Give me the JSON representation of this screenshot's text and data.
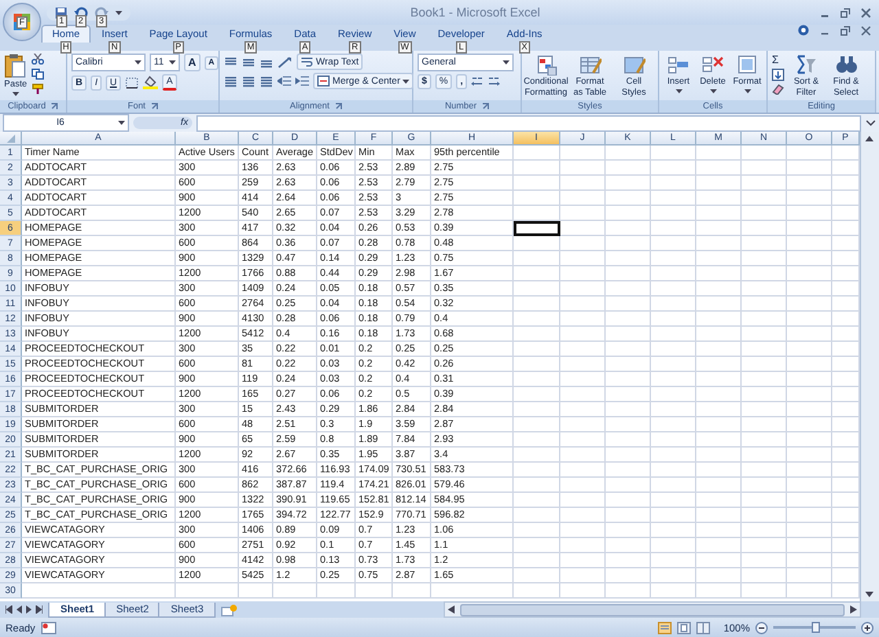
{
  "window": {
    "title": "Book1 - Microsoft Excel",
    "office_keytip": "F",
    "quick_access_keytips": [
      "1",
      "2",
      "3"
    ]
  },
  "tabs": [
    {
      "label": "Home",
      "keytip": "H",
      "selected": true
    },
    {
      "label": "Insert",
      "keytip": "N",
      "selected": false
    },
    {
      "label": "Page Layout",
      "keytip": "P",
      "selected": false
    },
    {
      "label": "Formulas",
      "keytip": "M",
      "selected": false
    },
    {
      "label": "Data",
      "keytip": "A",
      "selected": false
    },
    {
      "label": "Review",
      "keytip": "R",
      "selected": false
    },
    {
      "label": "View",
      "keytip": "W",
      "selected": false
    },
    {
      "label": "Developer",
      "keytip": "L",
      "selected": false
    },
    {
      "label": "Add-Ins",
      "keytip": "X",
      "selected": false
    }
  ],
  "clipboard": {
    "label": "Clipboard",
    "paste": "Paste"
  },
  "font": {
    "label": "Font",
    "name": "Calibri",
    "size": "11",
    "grow": "A",
    "shrink": "A",
    "bold": "B",
    "italic": "I",
    "underline": "U",
    "color_button": "A"
  },
  "alignment": {
    "label": "Alignment",
    "wrap": "Wrap Text",
    "merge": "Merge & Center"
  },
  "number": {
    "label": "Number",
    "format": "General",
    "currency": "$",
    "percent": "%",
    "comma": ","
  },
  "styles": {
    "label": "Styles",
    "buttons": [
      "Conditional Formatting",
      "Format as Table",
      "Cell Styles"
    ]
  },
  "cells_group": {
    "label": "Cells",
    "buttons": [
      "Insert",
      "Delete",
      "Format"
    ]
  },
  "editing": {
    "label": "Editing",
    "sum": "Σ",
    "buttons": [
      "Sort & Filter",
      "Find & Select"
    ]
  },
  "formula_bar": {
    "name_box": "I6",
    "function_label": "fx"
  },
  "columns": [
    {
      "label": "A",
      "selected": false
    },
    {
      "label": "B",
      "selected": false
    },
    {
      "label": "C",
      "selected": false
    },
    {
      "label": "D",
      "selected": false
    },
    {
      "label": "E",
      "selected": false
    },
    {
      "label": "F",
      "selected": false
    },
    {
      "label": "G",
      "selected": false
    },
    {
      "label": "H",
      "selected": false
    },
    {
      "label": "I",
      "selected": true
    },
    {
      "label": "J",
      "selected": false
    },
    {
      "label": "K",
      "selected": false
    },
    {
      "label": "L",
      "selected": false
    },
    {
      "label": "M",
      "selected": false
    },
    {
      "label": "N",
      "selected": false
    },
    {
      "label": "O",
      "selected": false
    },
    {
      "label": "P",
      "selected": false
    }
  ],
  "rows": [
    {
      "number": "1",
      "selected": false,
      "cells": [
        "Timer Name",
        "Active Users",
        "Count",
        "Average",
        "StdDev",
        "Min",
        "Max",
        "95th percentile"
      ]
    },
    {
      "number": "2",
      "selected": false,
      "cells": [
        "ADDTOCART",
        "300",
        "136",
        "2.63",
        "0.06",
        "2.53",
        "2.89",
        "2.75"
      ]
    },
    {
      "number": "3",
      "selected": false,
      "cells": [
        "ADDTOCART",
        "600",
        "259",
        "2.63",
        "0.06",
        "2.53",
        "2.79",
        "2.75"
      ]
    },
    {
      "number": "4",
      "selected": false,
      "cells": [
        "ADDTOCART",
        "900",
        "414",
        "2.64",
        "0.06",
        "2.53",
        "3",
        "2.75"
      ]
    },
    {
      "number": "5",
      "selected": false,
      "cells": [
        "ADDTOCART",
        "1200",
        "540",
        "2.65",
        "0.07",
        "2.53",
        "3.29",
        "2.78"
      ]
    },
    {
      "number": "6",
      "selected": true,
      "cells": [
        "HOMEPAGE",
        "300",
        "417",
        "0.32",
        "0.04",
        "0.26",
        "0.53",
        "0.39"
      ]
    },
    {
      "number": "7",
      "selected": false,
      "cells": [
        "HOMEPAGE",
        "600",
        "864",
        "0.36",
        "0.07",
        "0.28",
        "0.78",
        "0.48"
      ]
    },
    {
      "number": "8",
      "selected": false,
      "cells": [
        "HOMEPAGE",
        "900",
        "1329",
        "0.47",
        "0.14",
        "0.29",
        "1.23",
        "0.75"
      ]
    },
    {
      "number": "9",
      "selected": false,
      "cells": [
        "HOMEPAGE",
        "1200",
        "1766",
        "0.88",
        "0.44",
        "0.29",
        "2.98",
        "1.67"
      ]
    },
    {
      "number": "10",
      "selected": false,
      "cells": [
        "INFOBUY",
        "300",
        "1409",
        "0.24",
        "0.05",
        "0.18",
        "0.57",
        "0.35"
      ]
    },
    {
      "number": "11",
      "selected": false,
      "cells": [
        "INFOBUY",
        "600",
        "2764",
        "0.25",
        "0.04",
        "0.18",
        "0.54",
        "0.32"
      ]
    },
    {
      "number": "12",
      "selected": false,
      "cells": [
        "INFOBUY",
        "900",
        "4130",
        "0.28",
        "0.06",
        "0.18",
        "0.79",
        "0.4"
      ]
    },
    {
      "number": "13",
      "selected": false,
      "cells": [
        "INFOBUY",
        "1200",
        "5412",
        "0.4",
        "0.16",
        "0.18",
        "1.73",
        "0.68"
      ]
    },
    {
      "number": "14",
      "selected": false,
      "cells": [
        "PROCEEDTOCHECKOUT",
        "300",
        "35",
        "0.22",
        "0.01",
        "0.2",
        "0.25",
        "0.25"
      ]
    },
    {
      "number": "15",
      "selected": false,
      "cells": [
        "PROCEEDTOCHECKOUT",
        "600",
        "81",
        "0.22",
        "0.03",
        "0.2",
        "0.42",
        "0.26"
      ]
    },
    {
      "number": "16",
      "selected": false,
      "cells": [
        "PROCEEDTOCHECKOUT",
        "900",
        "119",
        "0.24",
        "0.03",
        "0.2",
        "0.4",
        "0.31"
      ]
    },
    {
      "number": "17",
      "selected": false,
      "cells": [
        "PROCEEDTOCHECKOUT",
        "1200",
        "165",
        "0.27",
        "0.06",
        "0.2",
        "0.5",
        "0.39"
      ]
    },
    {
      "number": "18",
      "selected": false,
      "cells": [
        "SUBMITORDER",
        "300",
        "15",
        "2.43",
        "0.29",
        "1.86",
        "2.84",
        "2.84"
      ]
    },
    {
      "number": "19",
      "selected": false,
      "cells": [
        "SUBMITORDER",
        "600",
        "48",
        "2.51",
        "0.3",
        "1.9",
        "3.59",
        "2.87"
      ]
    },
    {
      "number": "20",
      "selected": false,
      "cells": [
        "SUBMITORDER",
        "900",
        "65",
        "2.59",
        "0.8",
        "1.89",
        "7.84",
        "2.93"
      ]
    },
    {
      "number": "21",
      "selected": false,
      "cells": [
        "SUBMITORDER",
        "1200",
        "92",
        "2.67",
        "0.35",
        "1.95",
        "3.87",
        "3.4"
      ]
    },
    {
      "number": "22",
      "selected": false,
      "cells": [
        "T_BC_CAT_PURCHASE_ORIG",
        "300",
        "416",
        "372.66",
        "116.93",
        "174.09",
        "730.51",
        "583.73"
      ]
    },
    {
      "number": "23",
      "selected": false,
      "cells": [
        "T_BC_CAT_PURCHASE_ORIG",
        "600",
        "862",
        "387.87",
        "119.4",
        "174.21",
        "826.01",
        "579.46"
      ]
    },
    {
      "number": "24",
      "selected": false,
      "cells": [
        "T_BC_CAT_PURCHASE_ORIG",
        "900",
        "1322",
        "390.91",
        "119.65",
        "152.81",
        "812.14",
        "584.95"
      ]
    },
    {
      "number": "25",
      "selected": false,
      "cells": [
        "T_BC_CAT_PURCHASE_ORIG",
        "1200",
        "1765",
        "394.72",
        "122.77",
        "152.9",
        "770.71",
        "596.82"
      ]
    },
    {
      "number": "26",
      "selected": false,
      "cells": [
        "VIEWCATAGORY",
        "300",
        "1406",
        "0.89",
        "0.09",
        "0.7",
        "1.23",
        "1.06"
      ]
    },
    {
      "number": "27",
      "selected": false,
      "cells": [
        "VIEWCATAGORY",
        "600",
        "2751",
        "0.92",
        "0.1",
        "0.7",
        "1.45",
        "1.1"
      ]
    },
    {
      "number": "28",
      "selected": false,
      "cells": [
        "VIEWCATAGORY",
        "900",
        "4142",
        "0.98",
        "0.13",
        "0.73",
        "1.73",
        "1.2"
      ]
    },
    {
      "number": "29",
      "selected": false,
      "cells": [
        "VIEWCATAGORY",
        "1200",
        "5425",
        "1.2",
        "0.25",
        "0.75",
        "2.87",
        "1.65"
      ]
    },
    {
      "number": "30",
      "selected": false
    }
  ],
  "sheets": [
    {
      "label": "Sheet1",
      "selected": true
    },
    {
      "label": "Sheet2",
      "selected": false
    },
    {
      "label": "Sheet3",
      "selected": false
    }
  ],
  "status_bar": {
    "status": "Ready",
    "zoom": {
      "label": "100%",
      "level": 0.5
    }
  }
}
